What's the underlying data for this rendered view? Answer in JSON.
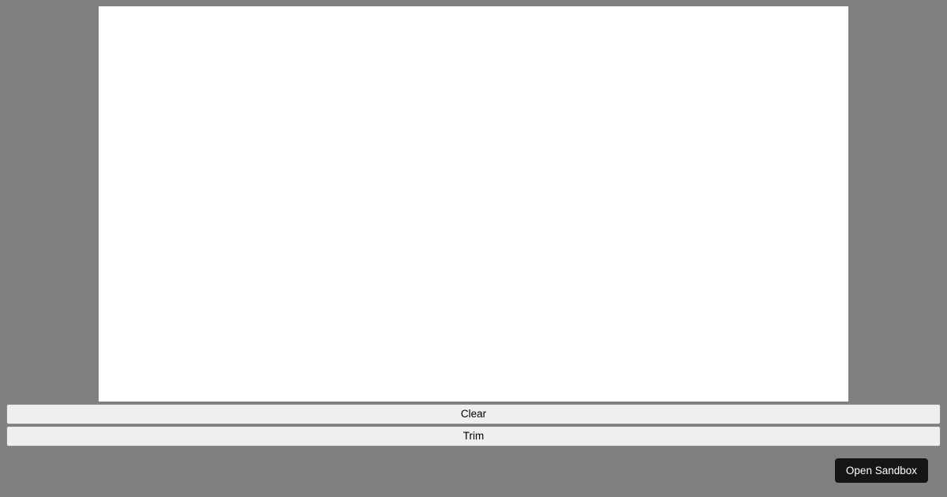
{
  "buttons": {
    "clear": "Clear",
    "trim": "Trim",
    "sandbox": "Open Sandbox"
  }
}
